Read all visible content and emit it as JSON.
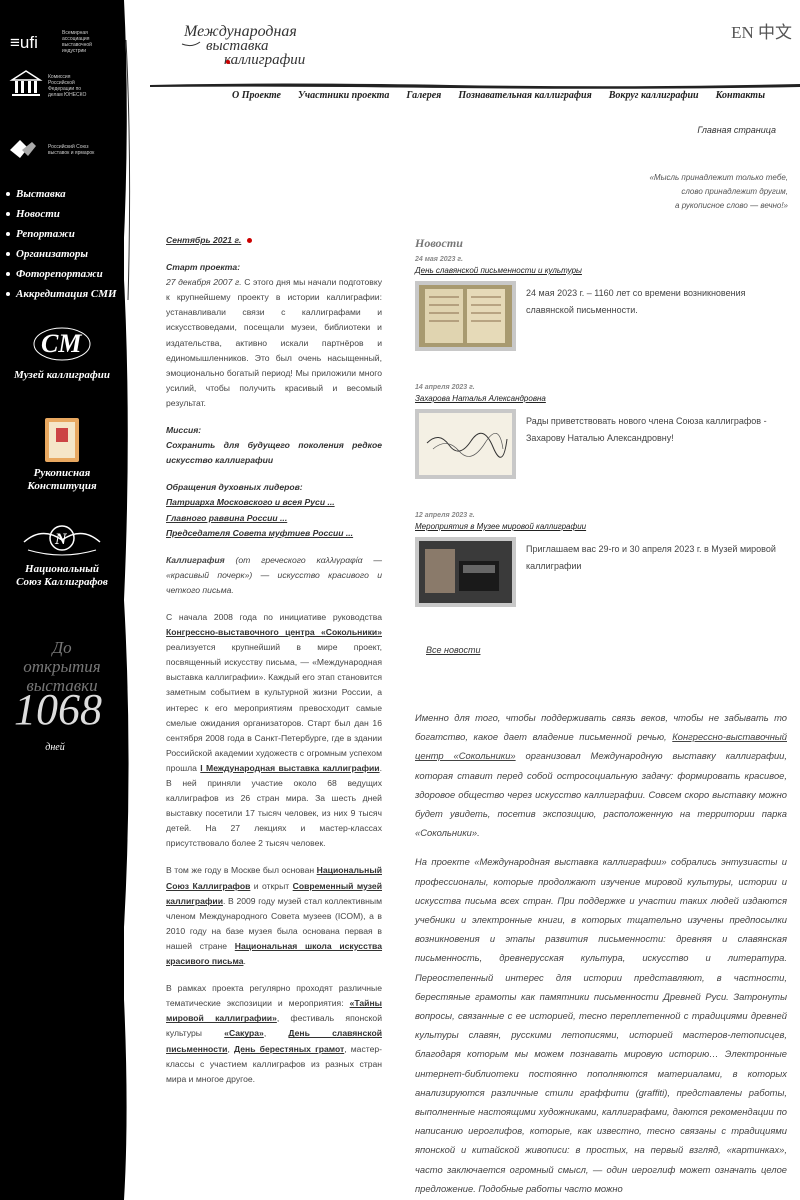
{
  "partners": [
    {
      "label": "Всемирная ассоциация выставочной индустрии"
    },
    {
      "label": "Комиссия Российской Федерации по делам ЮНЕСКО"
    },
    {
      "label": "Российский Союз выставок и ярмарок"
    }
  ],
  "sidebar": {
    "nav": [
      "Выставка",
      "Новости",
      "Репортажи",
      "Организаторы",
      "Фоторепортажи",
      "Аккредитация СМИ"
    ],
    "museum": "Музей каллиграфии",
    "constitution": "Рукописная Конституция",
    "union": "Национальный Союз Каллиграфов",
    "countdown_label": "До открытия выставки",
    "countdown_value": "1068",
    "countdown_unit": "дней"
  },
  "header": {
    "logo_alt": "Международная выставка каллиграфии",
    "lang_en": "EN",
    "lang_zh": "中文",
    "nav": [
      "О Проекте",
      "Участники проекта",
      "Галерея",
      "Познавательная каллиграфия",
      "Вокруг каллиграфии",
      "Контакты"
    ],
    "breadcrumb": "Главная страница",
    "quote": [
      "«Мысль принадлежит только тебе,",
      "слово принадлежит другим,",
      "а рукописное слово — вечно!»"
    ]
  },
  "left": {
    "month": "Сентябрь 2021 г.",
    "start_h": "Старт проекта:",
    "start_date": "27 декабря 2007 г.",
    "start_text": " С этого дня мы начали подготовку к крупнейшему проекту в истории каллиграфии: устанавливали связи с каллиграфами и искусствоведами, посещали музеи, библиотеки и издательства, активно искали партнёров и единомышленников. Это был очень насыщенный, эмоционально богатый период! Мы приложили много усилий, чтобы получить красивый и весомый результат.",
    "mission_h": "Миссия:",
    "mission": "Сохранить для будущего поколения редкое искусство каллиграфии",
    "leaders_h": "Обращения духовных лидеров:",
    "leaders": [
      "Патриарха Московского и всея Руси ...",
      "Главного раввина России ...",
      "Председателя Совета муфтиев России ..."
    ],
    "callig_b": "Каллиграфия",
    "callig_t": " (от греческого καλλιγραφία — «красивый почерк») — искусство красивого и четкого письма.",
    "p1a": "С начала 2008 года по инициативе руководства ",
    "p1b": "Конгрессно-выставочного центра «Сокольники»",
    "p1c": " реализуется крупнейший в мире проект, посвященный искусству письма, — «Международная выставка каллиграфии». Каждый его этап становится заметным событием в культурной жизни России, а интерес к его мероприятиям превосходит самые смелые ожидания организаторов. Старт был дан 16 сентября 2008 года в Санкт-Петербурге, где в здании Российской академии художеств с огромным успехом прошла ",
    "p1d": "I Международная выставка каллиграфии",
    "p1e": ". В ней приняли участие около 68 ведущих каллиграфов из 26 стран мира. За шесть дней выставку посетили 17 тысяч человек, из них 9 тысяч детей. На 27 лекциях и мастер-классах присутствовало более 2 тысяч человек.",
    "p2a": "В том же году в Москве был основан ",
    "p2b": "Национальный Союз Каллиграфов",
    "p2c": " и открыт ",
    "p2d": "Современный музей каллиграфии",
    "p2e": ". В 2009 году музей стал коллективным членом Международного Совета музеев (ICOM), а в 2010 году на базе музея была основана первая в нашей стране ",
    "p2f": "Национальная школа искусства красивого письма",
    "p2g": ".",
    "p3a": "В рамках проекта регулярно проходят различные тематические экспозиции и мероприятия: ",
    "p3b": "«Тайны мировой каллиграфии»",
    "p3c": ", фестиваль японской культуры ",
    "p3d": "«Сакура»",
    "p3e": ", ",
    "p3f": "День славянской письменности",
    "p3g": ", ",
    "p3h": "День берестяных грамот",
    "p3i": ", мастер-классы с участием каллиграфов из разных стран мира и многое другое."
  },
  "news": {
    "heading": "Новости",
    "items": [
      {
        "date": "24 мая 2023 г.",
        "title": "День славянской письменности и культуры",
        "text": "24 мая 2023 г. – 1160 лет со времени возникновения славянской письменности."
      },
      {
        "date": "14 апреля 2023 г.",
        "title": "Захарова Наталья Александровна",
        "text": "Рады приветствовать нового члена Союза каллиграфов - Захарову Наталью Александровну!"
      },
      {
        "date": "12 апреля 2023 г.",
        "title": "Мероприятия в Музее мировой каллиграфии",
        "text": "Приглашаем вас 29-го и 30 апреля 2023 г. в Музей мировой каллиграфии"
      }
    ],
    "all": "Все новости"
  },
  "right": {
    "p1a": "Именно для того, чтобы поддерживать связь веков, чтобы не забывать то богатство, какое дает владение письменной речью, ",
    "p1b": "Конгрессно-выставочный центр «Сокольники»",
    "p1c": " организовал Международную выставку каллиграфии, которая ставит перед собой остросоциальную задачу: формировать красивое, здоровое общество через искусство каллиграфии. Совсем скоро выставку можно будет увидеть, посетив экспозицию, расположенную на территории парка «Сокольники».",
    "p2": "На проекте «Международная выставка каллиграфии» собрались энтузиасты и профессионалы, которые продолжают изучение мировой культуры, истории и искусства письма всех стран. При поддержке и участии таких людей издаются учебники и электронные книги, в которых тщательно изучены предпосылки возникновения и этапы развития письменности: древняя и славянская письменность, древнерусская культура, искусство и литература. Переостепенный интерес для истории представляют, в частности, берестяные грамоты как памятники письменности Древней Руси. Затронуты вопросы, связанные с ее историей, тесно переплетенной с традициями древней культуры славян, русскими летописями, историей мастеров-летописцев, благодаря которым мы можем познавать мировую историю… Электронные интернет-библиотеки постоянно пополняются материалами, в которых анализируются различные стили граффити (graffiti), представлены работы, выполненные настоящими художниками, каллиграфами, даются рекомендации по написанию иероглифов, которые, как известно, тесно связаны с традициями японской и китайской живописи: в простых, на первый взгляд, «картинках», часто заключается огромный смысл, — один иероглиф может означать целое предложение. Подобные работы часто можно"
  }
}
